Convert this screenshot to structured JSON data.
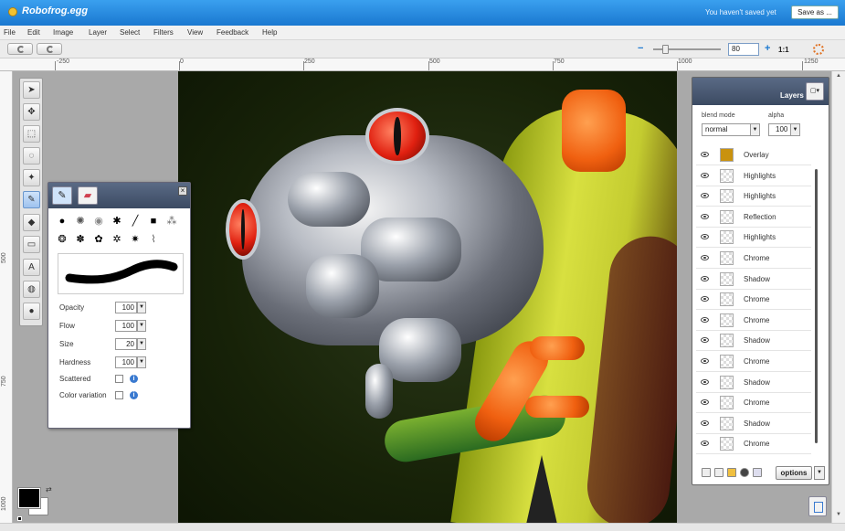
{
  "titlebar": {
    "doc_title": "Robofrog.egg",
    "save_status": "You haven't saved yet",
    "save_as_label": "Save as ..."
  },
  "menu": [
    "File",
    "Edit",
    "Image",
    "Layer",
    "Select",
    "Filters",
    "View",
    "Feedback",
    "Help"
  ],
  "toolbar": {
    "undo_icon": "undo-icon",
    "redo_icon": "redo-icon",
    "zoom_value": "80",
    "zoom_actual_label": "1:1",
    "zoom_fraction": 0.14
  },
  "ruler": {
    "top_labels": [
      "-250",
      "0",
      "250",
      "500",
      "750",
      "1000",
      "1250"
    ],
    "left_labels": [
      "500",
      "750",
      "1000"
    ]
  },
  "tools": [
    "pointer-icon",
    "move-icon",
    "marquee-icon",
    "lasso-icon",
    "wand-icon",
    "pencil-icon",
    "paintbucket-icon",
    "fill-icon",
    "type-icon",
    "stamp-icon",
    "colorpicker-icon"
  ],
  "colors": {
    "foreground": "#000000",
    "background": "#ffffff"
  },
  "brush_panel": {
    "tabs": [
      "brush-icon",
      "eraser-icon"
    ],
    "properties": [
      {
        "label": "Opacity",
        "value": "100"
      },
      {
        "label": "Flow",
        "value": "100"
      },
      {
        "label": "Size",
        "value": "20"
      },
      {
        "label": "Hardness",
        "value": "100"
      }
    ],
    "checks": [
      {
        "label": "Scattered",
        "checked": false
      },
      {
        "label": "Color variation",
        "checked": false
      }
    ]
  },
  "layers": {
    "title": "Layers",
    "blend_mode_label": "blend mode",
    "blend_mode_value": "normal",
    "alpha_label": "alpha",
    "alpha_value": "100",
    "items": [
      {
        "name": "Overlay",
        "thumb": "filled"
      },
      {
        "name": "Highlights",
        "thumb": "checker"
      },
      {
        "name": "Highlights",
        "thumb": "checker"
      },
      {
        "name": "Reflection",
        "thumb": "checker"
      },
      {
        "name": "Highlights",
        "thumb": "checker"
      },
      {
        "name": "Chrome",
        "thumb": "checker"
      },
      {
        "name": "Shadow",
        "thumb": "checker"
      },
      {
        "name": "Chrome",
        "thumb": "checker"
      },
      {
        "name": "Chrome",
        "thumb": "checker"
      },
      {
        "name": "Shadow",
        "thumb": "checker"
      },
      {
        "name": "Chrome",
        "thumb": "checker"
      },
      {
        "name": "Shadow",
        "thumb": "checker"
      },
      {
        "name": "Chrome",
        "thumb": "checker"
      },
      {
        "name": "Shadow",
        "thumb": "checker"
      },
      {
        "name": "Chrome",
        "thumb": "checker"
      }
    ],
    "options_label": "options",
    "accent": "#3b4a62"
  }
}
